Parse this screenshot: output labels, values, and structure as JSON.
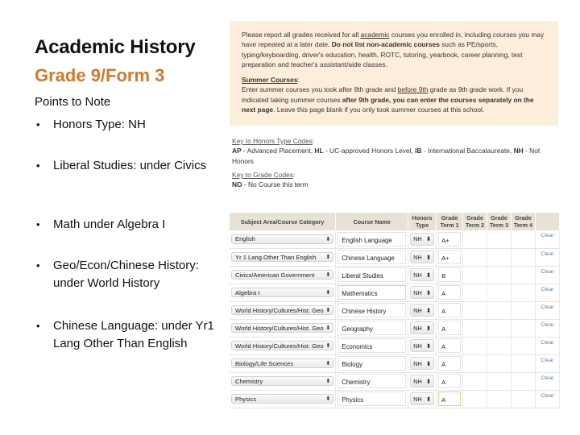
{
  "slide": {
    "title": "Academic History",
    "subtitle": "Grade 9/Form 3",
    "points_label": "Points to Note",
    "bullets": [
      "Honors Type: NH",
      "Liberal Studies: under Civics",
      "Math under Algebra I",
      "Geo/Econ/Chinese History: under World History",
      "Chinese Language: under Yr1 Lang Other Than English"
    ],
    "bullet_glyph": "•",
    "colors": {
      "subtitle": "#d2792b",
      "notice_bg": "#fdeedb",
      "clear_link": "#5b7fae"
    }
  },
  "notice": {
    "p1_a": "Please report all grades received for all ",
    "p1_link": "academic",
    "p1_b": " courses you enrolled in, including courses you may have repeated at a later date. ",
    "p1_bold": "Do not list non-academic courses",
    "p1_c": " such as PE/sports, typing/keyboarding, driver's education, health, ROTC, tutoring, yearbook, career planning, test preparation and teacher's assistant/aide classes.",
    "summer_title": "Summer Courses",
    "summer_colon": ":",
    "p2_a": "Enter summer courses you took after 8th grade and ",
    "p2_link": "before 9th",
    "p2_b": " grade as 9th grade work. If you indicated taking summer courses ",
    "p2_bold": "after 9th grade, you can enter the courses separately on the next page",
    "p2_c": ". Leave this page blank if you only took summer courses at this school."
  },
  "keys": {
    "honors_title": "Key to Honors Type Codes",
    "honors_codes": [
      {
        "code": "AP",
        "desc": " - Advanced Placement, "
      },
      {
        "code": "HL",
        "desc": " - UC-approved Honors Level, "
      },
      {
        "code": "IB",
        "desc": " - International Baccalaureate, "
      },
      {
        "code": "NH",
        "desc": " - Not Honors"
      }
    ],
    "grade_title": "Key to Grade Codes",
    "grade_codes": [
      {
        "code": "NO",
        "desc": " - No Course this term"
      }
    ],
    "colon": ":"
  },
  "table": {
    "headers": [
      "Subject Area/Course Category",
      "Course Name",
      "Honors Type",
      "Grade Term 1",
      "Grade Term 2",
      "Grade Term 3",
      "Grade Term 4"
    ],
    "clear_label": "Clear",
    "select_arrow": "⬍",
    "rows": [
      {
        "category": "English",
        "course": "English Language",
        "honors": "NH",
        "term1": "A+",
        "term2": "",
        "term3": "",
        "term4": ""
      },
      {
        "category": "Yr 1 Lang Other Than English",
        "course": "Chinese Language",
        "honors": "NH",
        "term1": "A+",
        "term2": "",
        "term3": "",
        "term4": ""
      },
      {
        "category": "Civics/American Government",
        "course": "Liberal Studies",
        "honors": "NH",
        "term1": "B",
        "term2": "",
        "term3": "",
        "term4": ""
      },
      {
        "category": "Algebra I",
        "course": "Mathematics",
        "honors": "NH",
        "term1": "A",
        "term2": "",
        "term3": "",
        "term4": ""
      },
      {
        "category": "World History/Cultures/Hist. Geo",
        "course": "Chinese History",
        "honors": "NH",
        "term1": "A",
        "term2": "",
        "term3": "",
        "term4": ""
      },
      {
        "category": "World History/Cultures/Hist. Geo",
        "course": "Geography",
        "honors": "NH",
        "term1": "A",
        "term2": "",
        "term3": "",
        "term4": ""
      },
      {
        "category": "World History/Cultures/Hist. Geo",
        "course": "Economics",
        "honors": "NH",
        "term1": "A",
        "term2": "",
        "term3": "",
        "term4": ""
      },
      {
        "category": "Biology/Life Sciences",
        "course": "Biology",
        "honors": "NH",
        "term1": "A",
        "term2": "",
        "term3": "",
        "term4": ""
      },
      {
        "category": "Chemistry",
        "course": "Chemistry",
        "honors": "NH",
        "term1": "A",
        "term2": "",
        "term3": "",
        "term4": ""
      },
      {
        "category": "Physics",
        "course": "Physics",
        "honors": "NH",
        "term1": "A",
        "term2": "",
        "term3": "",
        "term4": ""
      }
    ]
  }
}
